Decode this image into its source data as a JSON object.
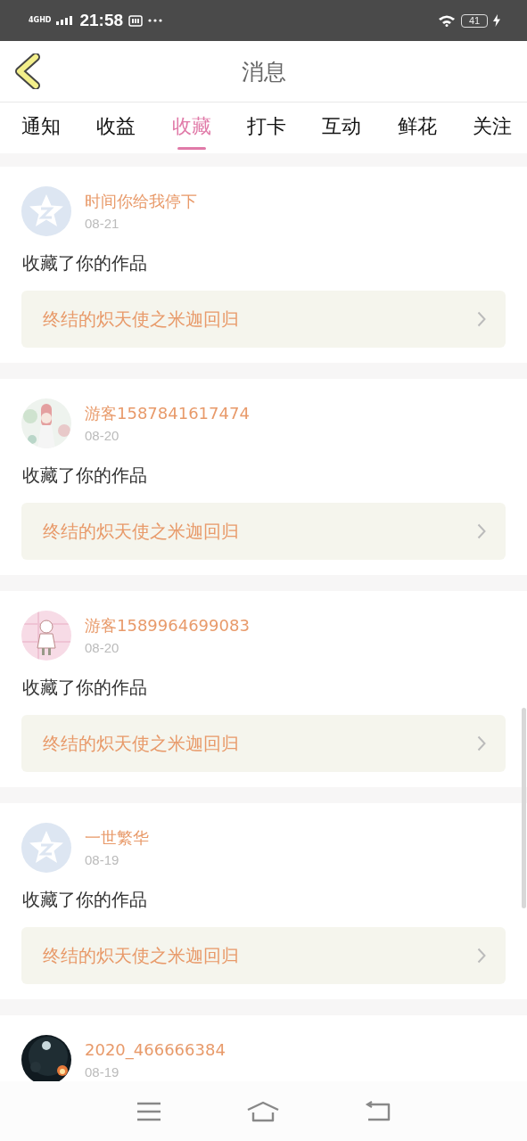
{
  "status_bar": {
    "network": "4GHD",
    "time": "21:58",
    "battery": "41"
  },
  "header": {
    "title": "消息"
  },
  "tabs": [
    {
      "label": "通知",
      "selected": false
    },
    {
      "label": "收益",
      "selected": false
    },
    {
      "label": "收藏",
      "selected": true
    },
    {
      "label": "打卡",
      "selected": false
    },
    {
      "label": "互动",
      "selected": false
    },
    {
      "label": "鲜花",
      "selected": false
    },
    {
      "label": "关注",
      "selected": false
    }
  ],
  "messages": [
    {
      "user": "时间你给我停下",
      "avatar": {
        "kind": "default"
      },
      "date": "08-21",
      "action": "收藏了你的作品",
      "work": "终结的炽天使之米迦回归"
    },
    {
      "user": "游客1587841617474",
      "date": "08-20",
      "action": "收藏了你的作品",
      "work": "终结的炽天使之米迦回归"
    },
    {
      "user": "游客1589964699083",
      "date": "08-20",
      "action": "收藏了你的作品",
      "work": "终结的炽天使之米迦回归"
    },
    {
      "user": "一世繁华",
      "avatar": {
        "kind": "default"
      },
      "date": "08-19",
      "action": "收藏了你的作品",
      "work": "终结的炽天使之米迦回归"
    },
    {
      "user": "2020_466666384",
      "date": "08-19"
    }
  ]
}
